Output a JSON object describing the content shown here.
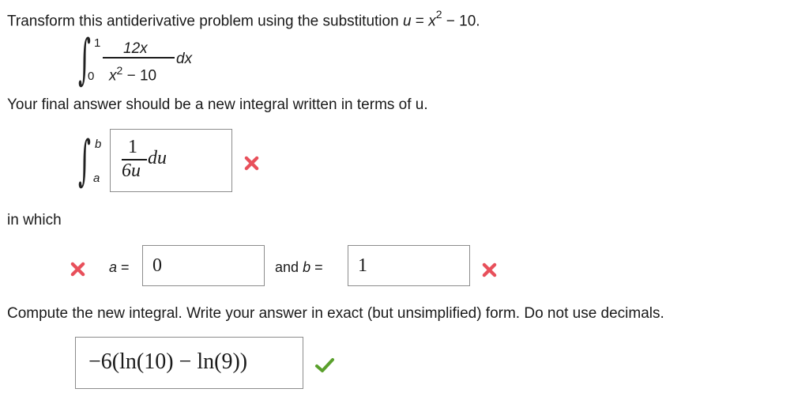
{
  "question": {
    "prompt_prefix": "Transform this antiderivative problem using the substitution",
    "u_var": "u",
    "equals": "=",
    "x_var": "x",
    "exp": "2",
    "minus_const": "− 10."
  },
  "integral1": {
    "upper": "1",
    "lower": "0",
    "numerator": "12x",
    "denominator_x": "x",
    "denominator_exp": "2",
    "denominator_rest": "− 10",
    "differential": "dx"
  },
  "instruction": "Your final answer should be a new integral written in terms of u.",
  "integral2": {
    "upper": "b",
    "lower": "a",
    "answer_numerator": "1",
    "answer_denominator": "6u",
    "answer_differential": "du",
    "status": "incorrect"
  },
  "in_which": "in which",
  "bounds": {
    "a_label": "a",
    "equals": "=",
    "a_value": "0",
    "a_status": "incorrect",
    "and_label": "and",
    "b_label": "b",
    "b_value": "1",
    "b_status": "incorrect"
  },
  "compute": {
    "instruction": "Compute the new integral. Write your answer in exact (but unsimplified) form. Do not use decimals.",
    "answer": "−6(ln(10) − ln(9))",
    "status": "correct"
  },
  "colors": {
    "incorrect": "#e8505b",
    "correct": "#5aa02c",
    "box_border": "#8c8c8c"
  }
}
